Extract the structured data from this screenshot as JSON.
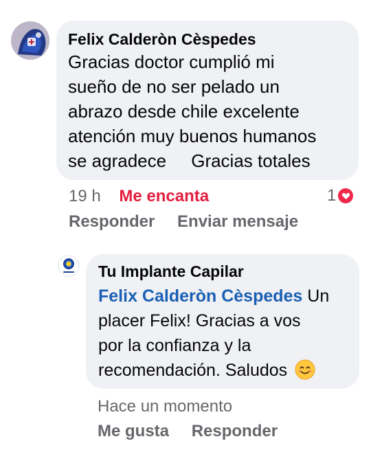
{
  "comment": {
    "author": "Felix Calderòn Cèspedes",
    "lines": [
      "Gracias doctor cumplió mi",
      "sueño de no ser pelado un",
      "abrazo desde chile excelente",
      "atención muy buenos humanos",
      "se agradece     Gracias totales"
    ],
    "time": "19 h",
    "reaction_label": "Me encanta",
    "reply_label": "Responder",
    "message_label": "Enviar mensaje",
    "reaction_count": "1",
    "reaction_icon": "heart-icon",
    "avatar_icon": "profile-photo-icon"
  },
  "reply": {
    "author": "Tu Implante Capilar",
    "mention": "Felix Calderòn Cèspedes",
    "lines": [
      " Un",
      "placer Felix! Gracias a vos",
      "por la confianza y la",
      "recomendación. Saludos "
    ],
    "emoji": "smiling-face-icon",
    "time": "Hace un momento",
    "like_label": "Me gusta",
    "reply_label": "Responder",
    "avatar_icon": "page-logo-icon"
  },
  "colors": {
    "bubble": "#eff1f4",
    "meta_gray": "#65676b",
    "love_red": "#e41e3f",
    "mention_blue": "#1a5fb4"
  }
}
